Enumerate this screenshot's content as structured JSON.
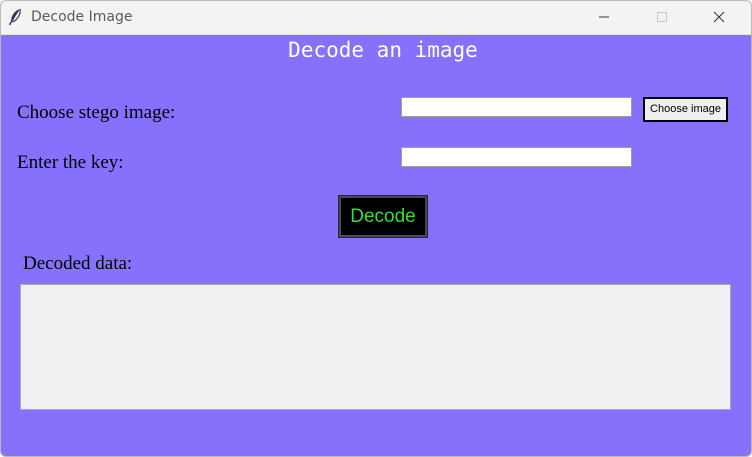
{
  "window": {
    "title": "Decode Image",
    "app_icon": "feather-icon",
    "controls": {
      "minimize_icon": "minimize-icon",
      "maximize_icon": "maximize-icon",
      "close_icon": "close-icon"
    }
  },
  "colors": {
    "background": "#8571fb",
    "heading_text": "#ffffff",
    "decode_button_bg": "#000000",
    "decode_button_text": "#33dd33"
  },
  "main": {
    "heading": "Decode an image",
    "choose_label": "Choose stego image:",
    "path_value": "",
    "choose_button_label": "Choose image",
    "key_label": "Enter the key:",
    "key_value": "",
    "decode_button_label": "Decode",
    "decoded_label": "Decoded data:",
    "decoded_value": ""
  }
}
